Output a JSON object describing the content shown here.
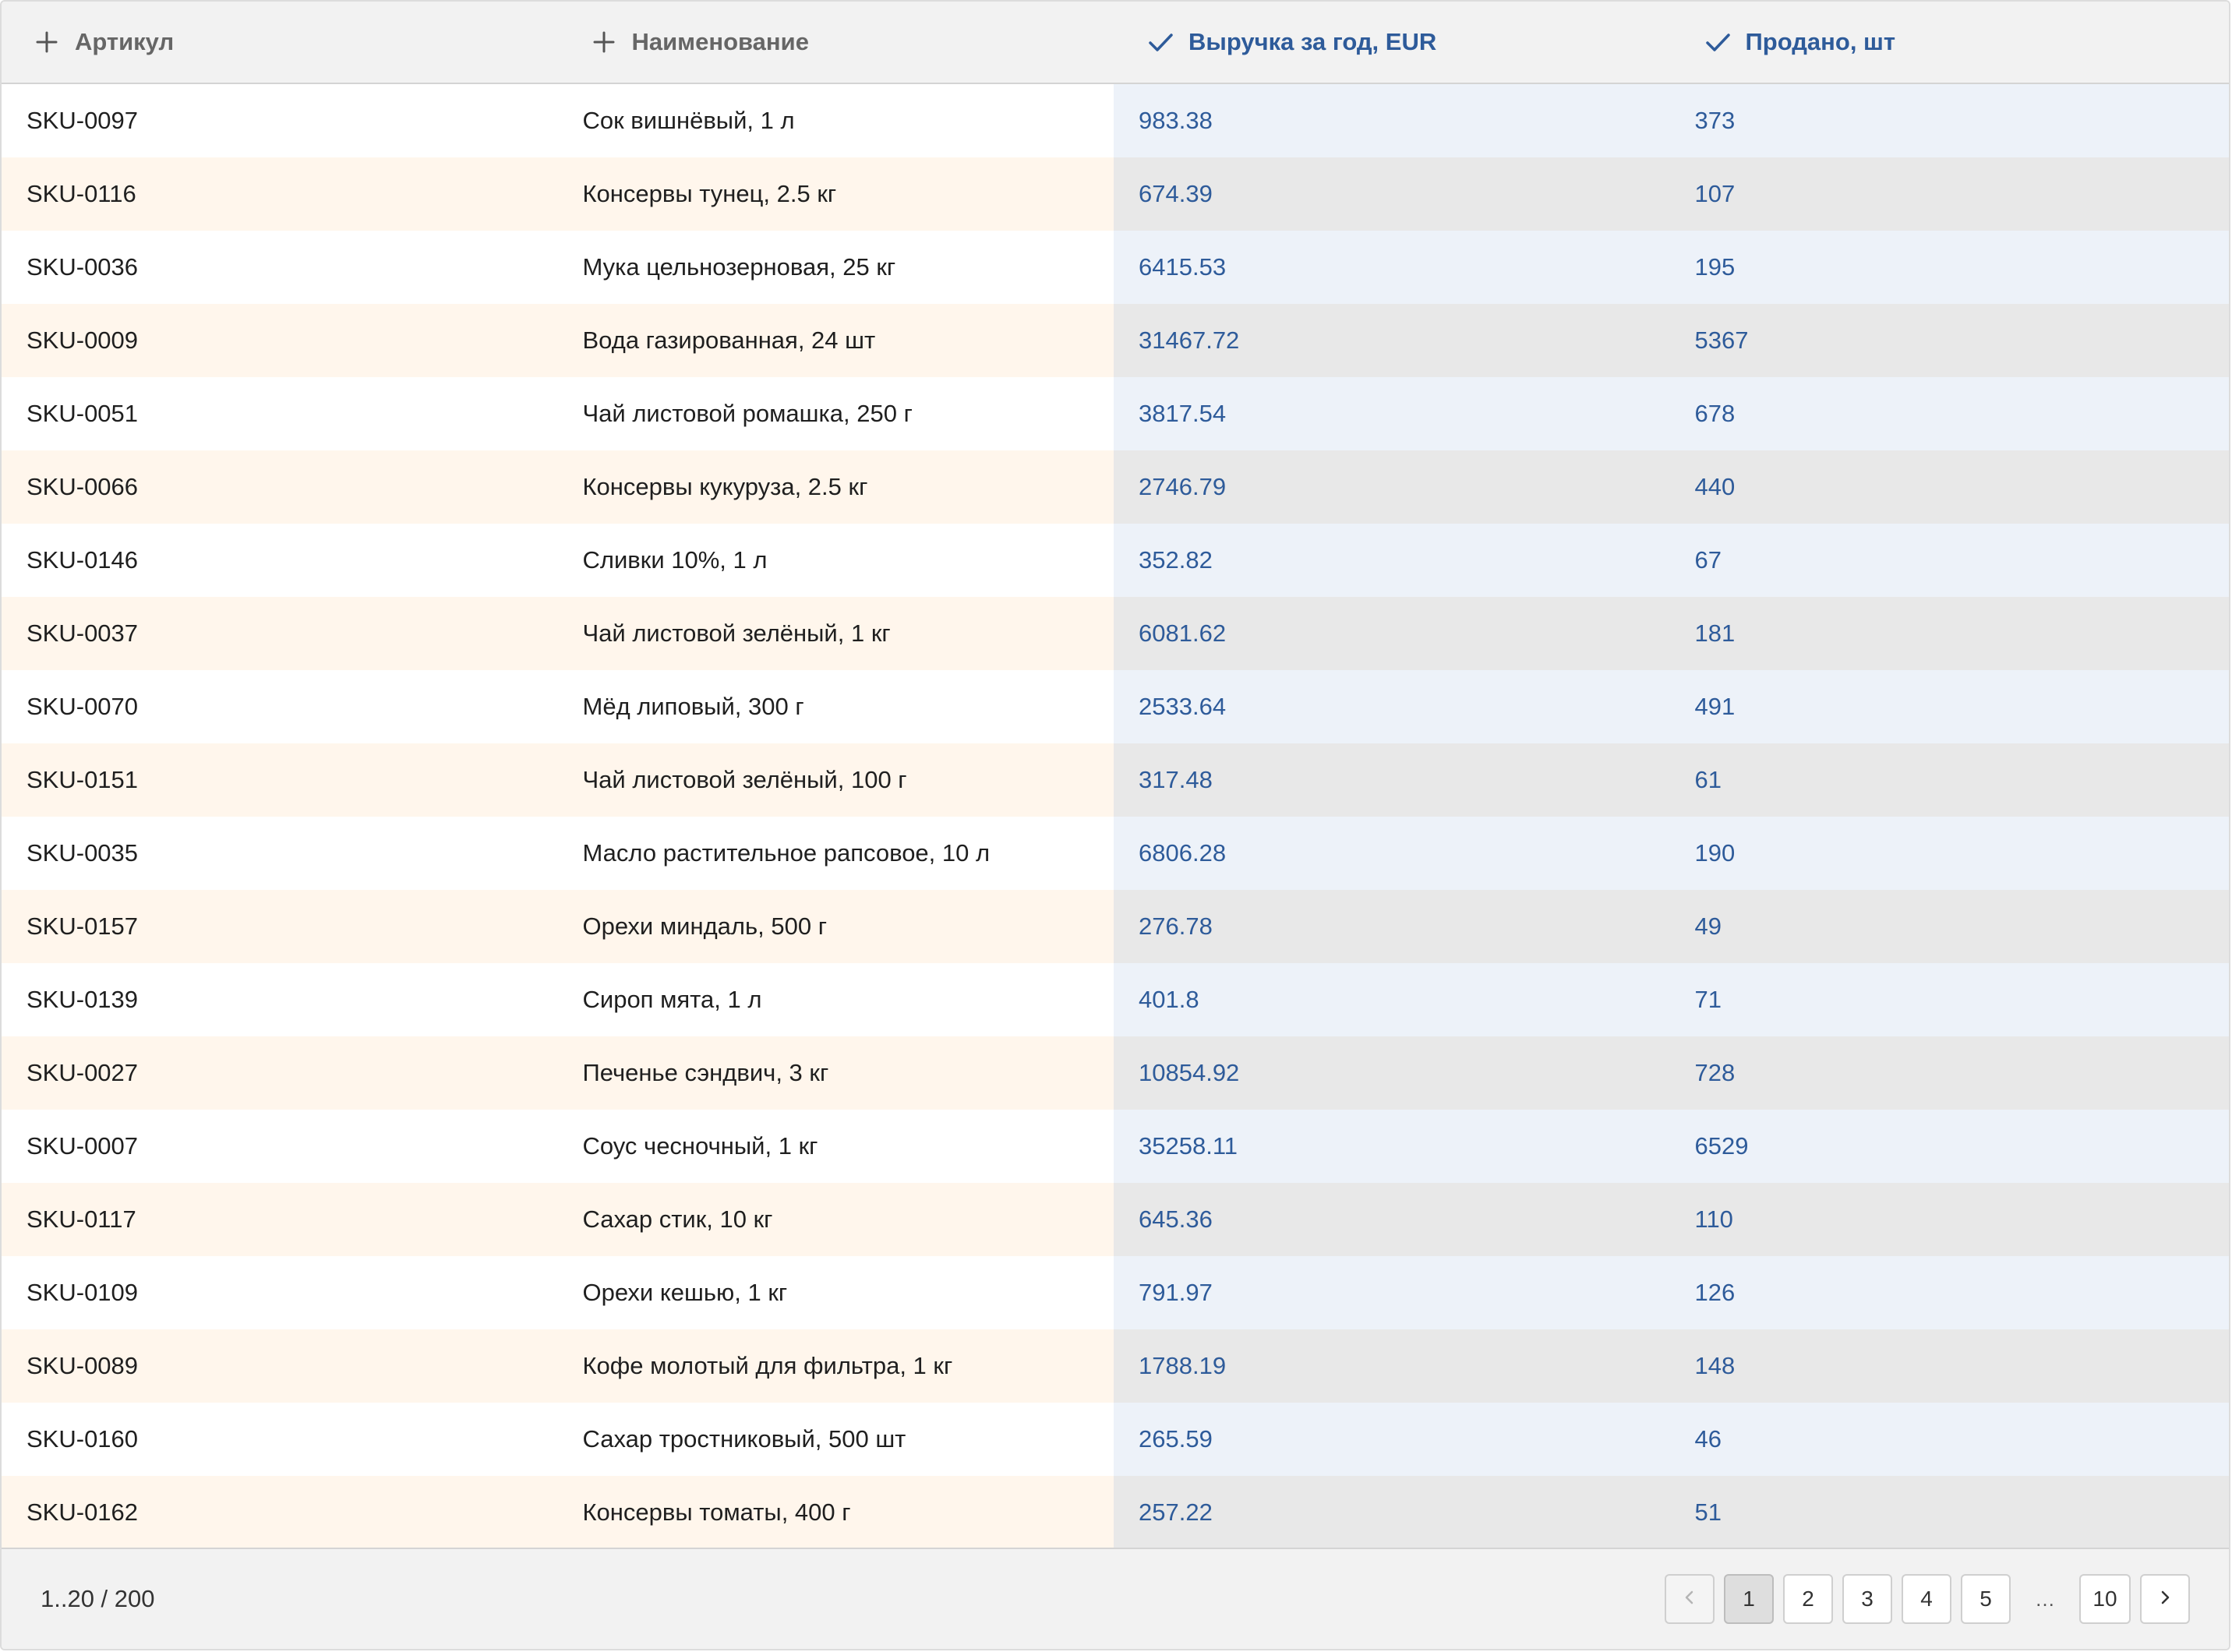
{
  "columns": [
    {
      "label": "Артикул",
      "icon": "plus-icon",
      "active": false
    },
    {
      "label": "Наименование",
      "icon": "plus-icon",
      "active": false
    },
    {
      "label": "Выручка за год, EUR",
      "icon": "check-icon",
      "active": true
    },
    {
      "label": "Продано, шт",
      "icon": "check-icon",
      "active": true
    }
  ],
  "rows": [
    [
      "SKU-0097",
      "Сок вишнёвый, 1 л",
      "983.38",
      "373"
    ],
    [
      "SKU-0116",
      "Консервы тунец, 2.5 кг",
      "674.39",
      "107"
    ],
    [
      "SKU-0036",
      "Мука цельнозерновая, 25 кг",
      "6415.53",
      "195"
    ],
    [
      "SKU-0009",
      "Вода газированная, 24 шт",
      "31467.72",
      "5367"
    ],
    [
      "SKU-0051",
      "Чай листовой ромашка, 250 г",
      "3817.54",
      "678"
    ],
    [
      "SKU-0066",
      "Консервы кукуруза, 2.5 кг",
      "2746.79",
      "440"
    ],
    [
      "SKU-0146",
      "Сливки 10%, 1 л",
      "352.82",
      "67"
    ],
    [
      "SKU-0037",
      "Чай листовой зелёный, 1 кг",
      "6081.62",
      "181"
    ],
    [
      "SKU-0070",
      "Мёд липовый, 300 г",
      "2533.64",
      "491"
    ],
    [
      "SKU-0151",
      "Чай листовой зелёный, 100 г",
      "317.48",
      "61"
    ],
    [
      "SKU-0035",
      "Масло растительное рапсовое, 10 л",
      "6806.28",
      "190"
    ],
    [
      "SKU-0157",
      "Орехи миндаль, 500 г",
      "276.78",
      "49"
    ],
    [
      "SKU-0139",
      "Сироп мята, 1 л",
      "401.8",
      "71"
    ],
    [
      "SKU-0027",
      "Печенье сэндвич, 3 кг",
      "10854.92",
      "728"
    ],
    [
      "SKU-0007",
      "Соус чесночный, 1 кг",
      "35258.11",
      "6529"
    ],
    [
      "SKU-0117",
      "Сахар стик, 10 кг",
      "645.36",
      "110"
    ],
    [
      "SKU-0109",
      "Орехи кешью, 1 кг",
      "791.97",
      "126"
    ],
    [
      "SKU-0089",
      "Кофе молотый для фильтра, 1 кг",
      "1788.19",
      "148"
    ],
    [
      "SKU-0160",
      "Сахар тростниковый, 500 шт",
      "265.59",
      "46"
    ],
    [
      "SKU-0162",
      "Консервы томаты, 400 г",
      "257.22",
      "51"
    ]
  ],
  "footer": {
    "range": "1..20 / 200",
    "pages": [
      "1",
      "2",
      "3",
      "4",
      "5"
    ],
    "ellipsis": "…",
    "last_page": "10",
    "current_page": "1",
    "prev_icon": "chevron-left-icon",
    "next_icon": "chevron-right-icon"
  },
  "colors": {
    "accent": "#2e5b9a",
    "header_bg": "#f2f2f2",
    "row_alt_bg": "#fff6ec",
    "selected_col_bg": "#edf2f9",
    "selected_col_alt_bg": "#e8e8e8"
  }
}
